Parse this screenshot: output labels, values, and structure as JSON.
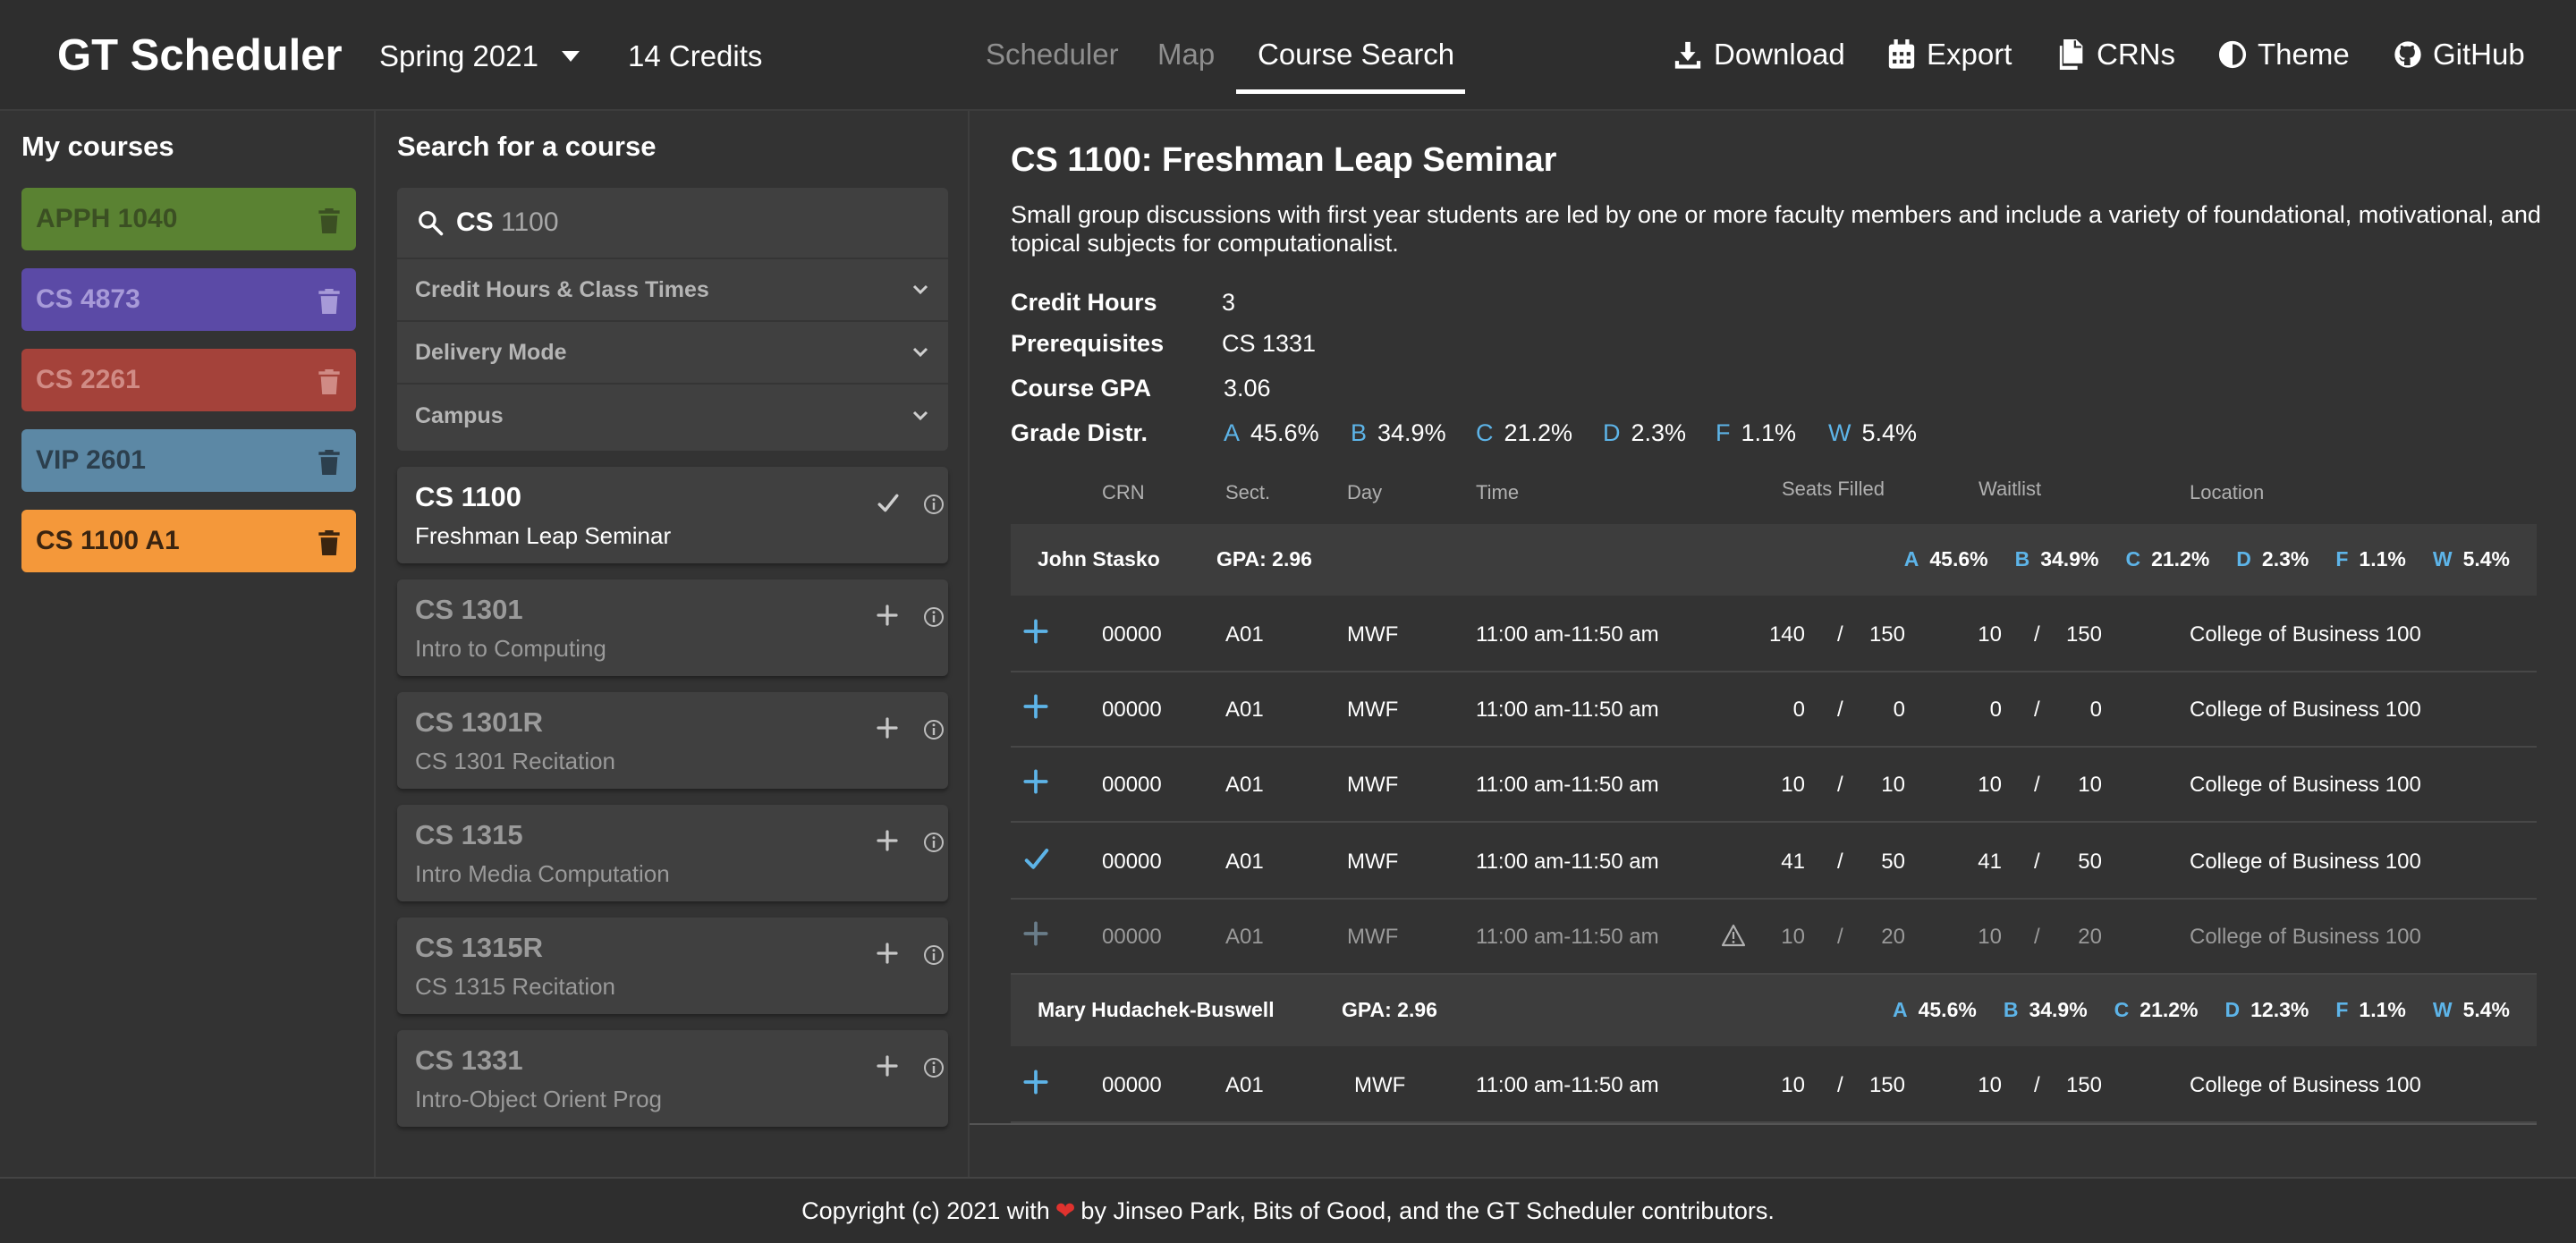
{
  "header": {
    "app_title": "GT Scheduler",
    "term": "Spring 2021",
    "credits": "14 Credits",
    "tabs": [
      {
        "label": "Scheduler",
        "active": false
      },
      {
        "label": "Map",
        "active": false
      },
      {
        "label": "Course Search",
        "active": true
      }
    ],
    "buttons": [
      {
        "label": "Download",
        "icon": "download-icon"
      },
      {
        "label": "Export",
        "icon": "calendar-icon"
      },
      {
        "label": "CRNs",
        "icon": "copy-icon"
      },
      {
        "label": "Theme",
        "icon": "contrast-icon"
      },
      {
        "label": "GitHub",
        "icon": "github-icon"
      }
    ]
  },
  "my_courses": {
    "title": "My courses",
    "items": [
      {
        "label": "APPH 1040",
        "color": "#5a8232",
        "text_color": "#3b4f23"
      },
      {
        "label": "CS 4873",
        "color": "#5b4aa6",
        "text_color": "#a79ad8"
      },
      {
        "label": "CS 2261",
        "color": "#a4423a",
        "text_color": "#d08b85"
      },
      {
        "label": "VIP 2601",
        "color": "#5c88a5",
        "text_color": "#2c3f4d"
      },
      {
        "label": "CS 1100 A1",
        "color": "#f4983a",
        "text_color": "#3a2410"
      }
    ]
  },
  "search": {
    "title": "Search for a course",
    "query_first": "CS",
    "query_rest": "1100",
    "filters": [
      "Credit Hours & Class Times",
      "Delivery Mode",
      "Campus"
    ],
    "results": [
      {
        "id": "CS 1100",
        "title": "Freshman Leap Seminar",
        "selected": true
      },
      {
        "id": "CS 1301",
        "title": "Intro to Computing",
        "selected": false
      },
      {
        "id": "CS 1301R",
        "title": "CS 1301 Recitation",
        "selected": false
      },
      {
        "id": "CS 1315",
        "title": "Intro Media Computation",
        "selected": false
      },
      {
        "id": "CS 1315R",
        "title": "CS 1315 Recitation",
        "selected": false
      },
      {
        "id": "CS 1331",
        "title": "Intro-Object Orient Prog",
        "selected": false
      }
    ]
  },
  "course": {
    "title": "CS 1100: Freshman Leap Seminar",
    "description": "Small group discussions with first year students are led by one or more faculty members and include a variety of foundational, motivational, and topical subjects for computationalist.",
    "credit_hours_label": "Credit Hours",
    "credit_hours": "3",
    "prereq_label": "Prerequisites",
    "prereq": "CS 1331",
    "gpa_label": "Course GPA",
    "gpa": "3.06",
    "grade_label": "Grade Distr.",
    "grades": [
      {
        "letter": "A",
        "value": "45.6%"
      },
      {
        "letter": "B",
        "value": "34.9%"
      },
      {
        "letter": "C",
        "value": "21.2%"
      },
      {
        "letter": "D",
        "value": "2.3%"
      },
      {
        "letter": "F",
        "value": "1.1%"
      },
      {
        "letter": "W",
        "value": "5.4%"
      }
    ]
  },
  "table": {
    "headers": {
      "crn": "CRN",
      "sect": "Sect.",
      "day": "Day",
      "time": "Time",
      "seats": "Seats Filled",
      "waitlist": "Waitlist",
      "location": "Location"
    },
    "instructors": [
      {
        "name": "John Stasko",
        "gpa": "GPA: 2.96",
        "grades": [
          {
            "letter": "A",
            "value": "45.6%"
          },
          {
            "letter": "B",
            "value": "34.9%"
          },
          {
            "letter": "C",
            "value": "21.2%"
          },
          {
            "letter": "D",
            "value": "2.3%"
          },
          {
            "letter": "F",
            "value": "1.1%"
          },
          {
            "letter": "W",
            "value": "5.4%"
          }
        ]
      },
      {
        "name": "Mary Hudachek-Buswell",
        "gpa": "GPA: 2.96",
        "grades": [
          {
            "letter": "A",
            "value": "45.6%"
          },
          {
            "letter": "B",
            "value": "34.9%"
          },
          {
            "letter": "C",
            "value": "21.2%"
          },
          {
            "letter": "D",
            "value": "12.3%"
          },
          {
            "letter": "F",
            "value": "1.1%"
          },
          {
            "letter": "W",
            "value": "5.4%"
          }
        ]
      }
    ],
    "rows": [
      {
        "action": "add",
        "crn": "00000",
        "sect": "A01",
        "day": "MWF",
        "time": "11:00 am-11:50 am",
        "seats_a": "140",
        "seats_b": "150",
        "wait_a": "10",
        "wait_b": "150",
        "location": "College of Business 100",
        "warning": false,
        "dim": false
      },
      {
        "action": "add",
        "crn": "00000",
        "sect": "A01",
        "day": "MWF",
        "time": "11:00 am-11:50 am",
        "seats_a": "0",
        "seats_b": "0",
        "wait_a": "0",
        "wait_b": "0",
        "location": "College of Business 100",
        "warning": false,
        "dim": false
      },
      {
        "action": "add",
        "crn": "00000",
        "sect": "A01",
        "day": "MWF",
        "time": "11:00 am-11:50 am",
        "seats_a": "10",
        "seats_b": "10",
        "wait_a": "10",
        "wait_b": "10",
        "location": "College of Business 100",
        "warning": false,
        "dim": false
      },
      {
        "action": "check",
        "crn": "00000",
        "sect": "A01",
        "day": "MWF",
        "time": "11:00 am-11:50 am",
        "seats_a": "41",
        "seats_b": "50",
        "wait_a": "41",
        "wait_b": "50",
        "location": "College of Business 100",
        "warning": false,
        "dim": false
      },
      {
        "action": "add",
        "crn": "00000",
        "sect": "A01",
        "day": "MWF",
        "time": "11:00 am-11:50 am",
        "seats_a": "10",
        "seats_b": "20",
        "wait_a": "10",
        "wait_b": "20",
        "location": "College of Business 100",
        "warning": true,
        "dim": true
      },
      {
        "action": "add",
        "crn": "00000",
        "sect": "A01",
        "day": "MWF",
        "time": "11:00 am-11:50 am",
        "seats_a": "10",
        "seats_b": "150",
        "wait_a": "10",
        "wait_b": "150",
        "location": "College of Business 100",
        "warning": false,
        "dim": false
      }
    ],
    "slash": "/"
  },
  "footer": {
    "before": "Copyright (c) 2021 with",
    "heart": "❤",
    "after": "by Jinseo Park, Bits of Good, and the GT Scheduler contributors."
  },
  "colors": {
    "accent": "#5db4e8",
    "background": "#333333",
    "header": "#2e2e2e",
    "panel": "#404040"
  }
}
